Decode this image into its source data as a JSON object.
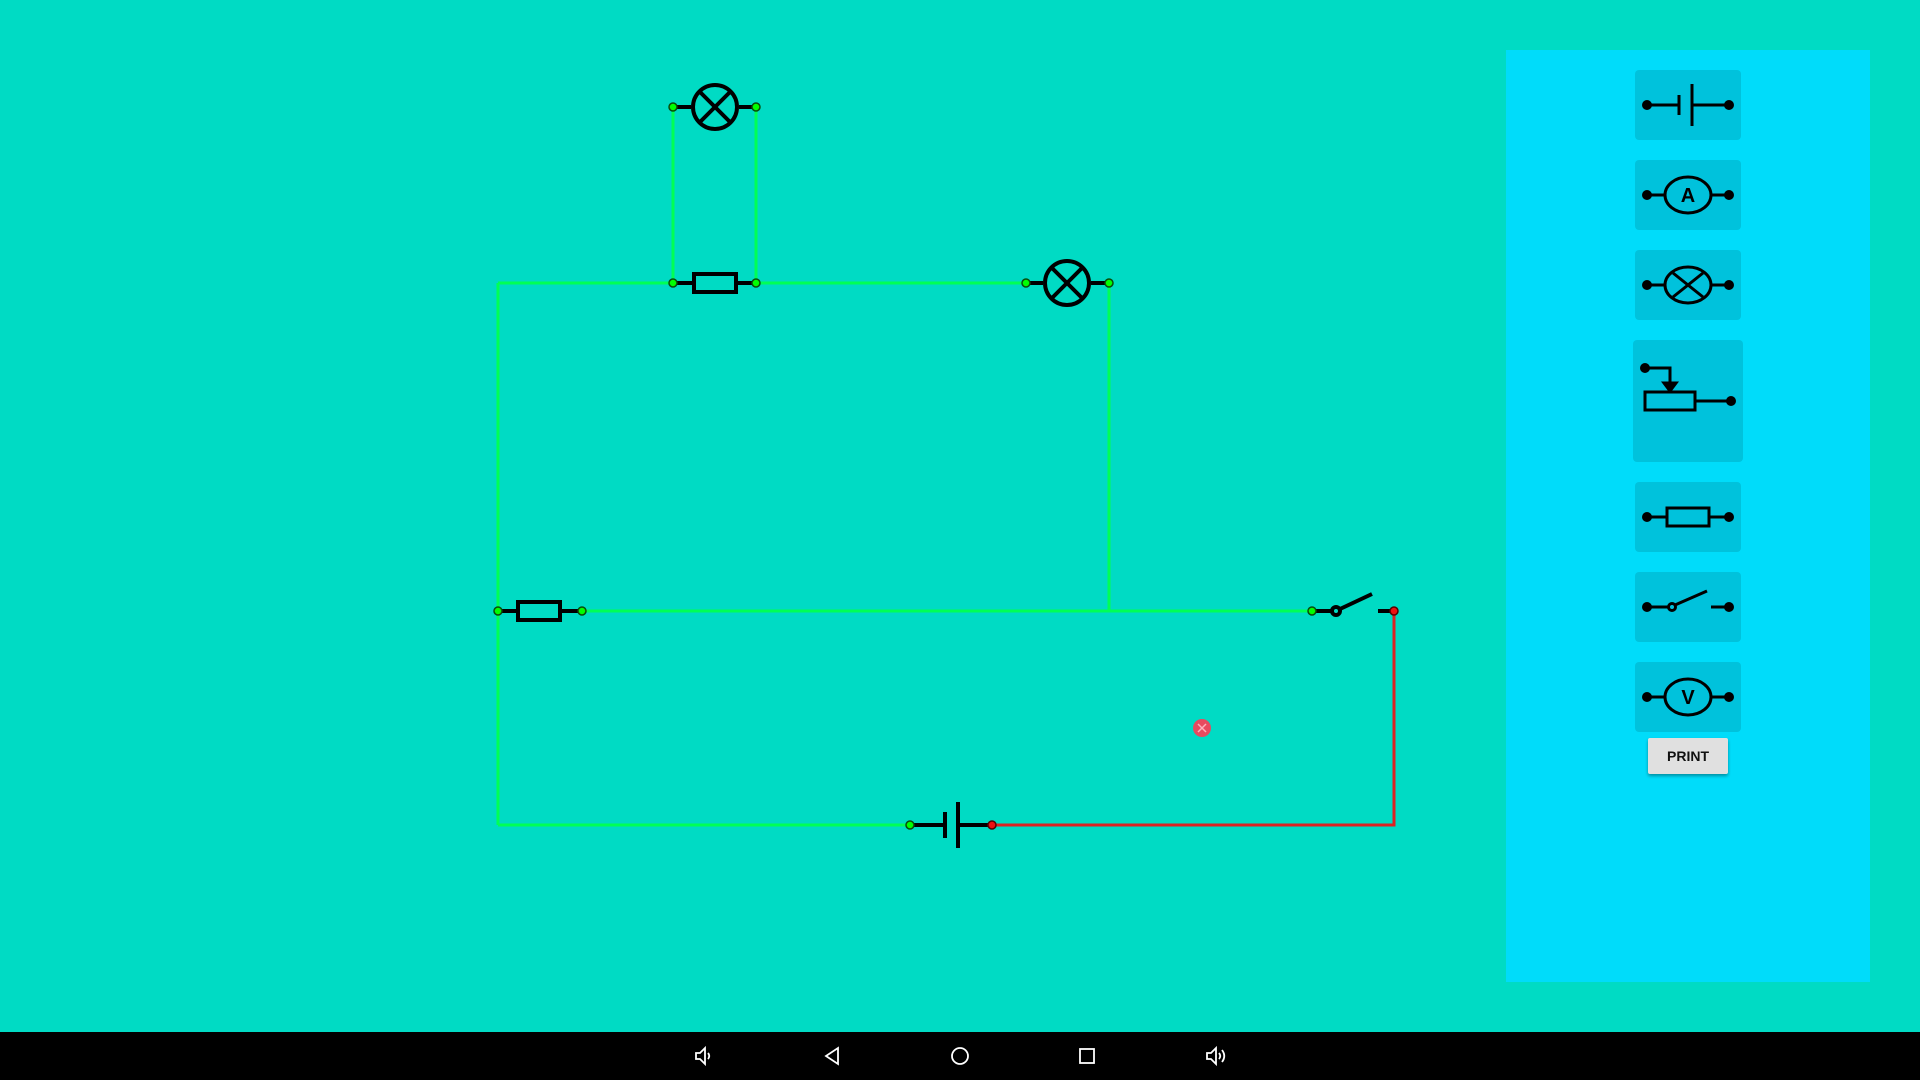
{
  "palette": {
    "items": [
      {
        "id": "cell",
        "icon": "cell-icon"
      },
      {
        "id": "ammeter",
        "icon": "ammeter-icon",
        "symbol": "A"
      },
      {
        "id": "lamp",
        "icon": "lamp-icon"
      },
      {
        "id": "rheostat",
        "icon": "rheostat-icon"
      },
      {
        "id": "resistor",
        "icon": "resistor-icon"
      },
      {
        "id": "switch",
        "icon": "switch-icon"
      },
      {
        "id": "voltmeter",
        "icon": "voltmeter-icon",
        "symbol": "V"
      }
    ],
    "print_label": "PRINT"
  },
  "circuit": {
    "components": [
      "lamp",
      "resistor",
      "lamp",
      "resistor",
      "switch",
      "cell"
    ],
    "delete_marker": "close-icon",
    "colors": {
      "wire_active": "#00ff55",
      "wire_inactive": "#dd2222",
      "delete_marker": "#e84a5f"
    }
  },
  "navbar": {
    "icons": [
      "volume-down-icon",
      "back-icon",
      "home-icon",
      "recents-icon",
      "volume-up-icon"
    ]
  },
  "colors": {
    "background": "#00dbc4",
    "palette_bg": "#00dcfa",
    "palette_button": "#00c2dc",
    "navbar": "#000000"
  }
}
